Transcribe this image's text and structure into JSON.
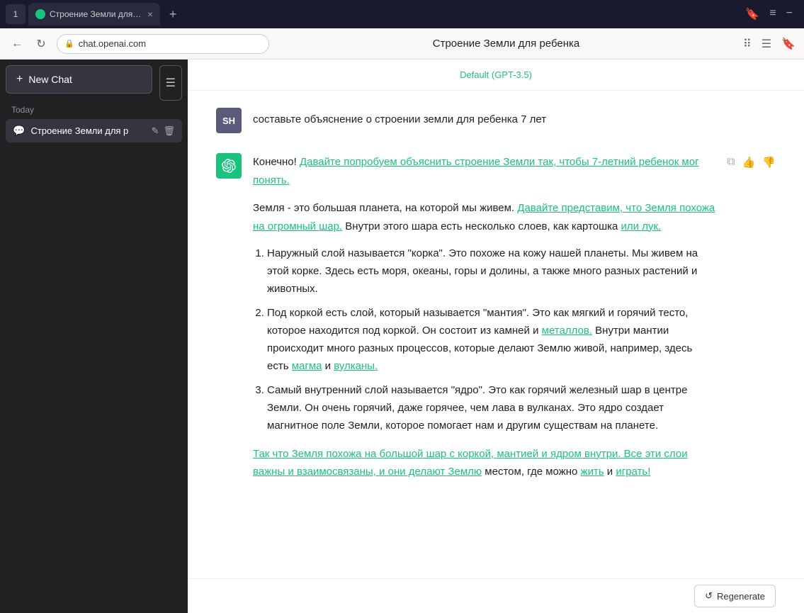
{
  "browser": {
    "tab_title": "Строение Земли для ре...",
    "tab_close": "×",
    "tab_add": "+",
    "window_controls": [
      "⊞",
      "≡",
      "−"
    ],
    "url": "chat.openai.com",
    "page_title": "Строение Земли для ребенка",
    "bar_icons": [
      "⠿",
      "☰",
      "🔖"
    ]
  },
  "sidebar": {
    "new_chat_label": "New Chat",
    "toggle_icon": "☰",
    "section_today": "Today",
    "chat_item_text": "Строение Земли для р",
    "chat_edit_icon": "✎",
    "chat_delete_icon": "🗑"
  },
  "chat": {
    "model_label": "Default (GPT-3.5)",
    "user_avatar": "SH",
    "user_message": "составьте объяснение о  строении земли для ребенка 7 лет",
    "ai_intro_1": "Конечно! Давайте попробуем объяснить строение Земли так, чтобы 7-летний ребенок мог понять.",
    "ai_intro_2": "Земля - это большая планета, на которой мы живем. Давайте представим, что Земля похожа на огромный шар. Внутри этого шара есть несколько слоев, как картошка или лук.",
    "ai_list": [
      {
        "num": "1.",
        "text": "Наружный слой называется \"корка\". Это похоже на кожу нашей планеты. Мы живем на этой корке. Здесь есть моря, океаны, горы и долины, а также много разных растений и животных."
      },
      {
        "num": "2.",
        "text": "Под коркой есть слой, который называется \"мантия\". Это как мягкий и горячий тесто, которое находится под коркой. Он состоит из камней и металлов. Внутри мантии происходит много разных процессов, которые делают Землю живой, например, здесь есть магма и вулканы."
      },
      {
        "num": "3.",
        "text": "Самый внутренний слой называется \"ядро\". Это как горячий железный шар в центре Земли. Он очень горячий, даже горячее, чем лава в вулканах. Это ядро создает магнитное поле Земли, которое помогает нам и другим существам на планете."
      }
    ],
    "ai_conclusion": "Так что Земля похожа на большой шар с коркой, мантией и ядром внутри. Все эти слои важны и взаимосвязаны, и они делают Землю местом, где можно жить и играть!",
    "action_copy": "⧉",
    "action_up": "👍",
    "action_down": "👎",
    "regenerate_label": "Regenerate",
    "regenerate_icon": "↺"
  }
}
